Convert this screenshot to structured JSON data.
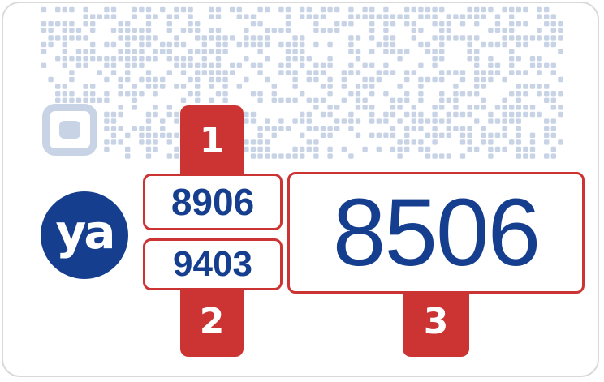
{
  "logo": {
    "text": "ya",
    "color": "#163e8f"
  },
  "badges": [
    {
      "number": "1",
      "code": "8906"
    },
    {
      "number": "2",
      "code": "9403"
    },
    {
      "number": "3",
      "code": "8506"
    }
  ],
  "colors": {
    "accent": "#cc3433",
    "text": "#163e8f",
    "qr": "#c8d4e6"
  },
  "qr_code": {
    "icon": "qr-code-icon"
  }
}
